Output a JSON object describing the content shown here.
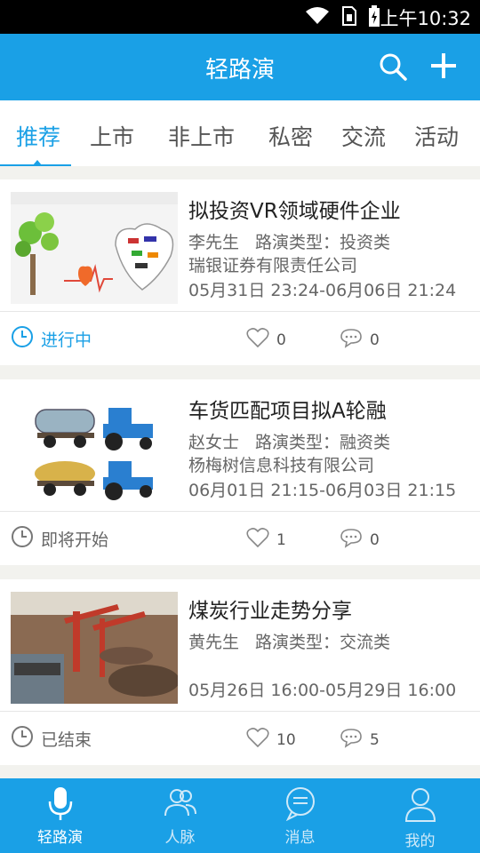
{
  "status_bar": {
    "time": "上午10:32"
  },
  "app_bar": {
    "title": "轻路演"
  },
  "tabs": [
    "推荐",
    "上市",
    "非上市",
    "私密",
    "交流",
    "活动"
  ],
  "cards": [
    {
      "title": "拟投资VR领域硬件企业",
      "person": "李先生",
      "type": "路演类型：投资类",
      "company": "瑞银证券有限责任公司",
      "time": "05月31日 23:24-06月06日 21:24",
      "status": "进行中",
      "likes": "0",
      "comments": "0",
      "thumb": "互联网共享经济插图"
    },
    {
      "title": "车货匹配项目拟A轮融",
      "person": "赵女士",
      "type": "路演类型：融资类",
      "company": "杨梅树信息科技有限公司",
      "time": "06月01日 21:15-06月03日 21:15",
      "status": "即将开始",
      "likes": "1",
      "comments": "0",
      "thumb": "拖拉机插图"
    },
    {
      "title": "煤炭行业走势分享",
      "person": "黄先生",
      "type": "路演类型：交流类",
      "company": "",
      "time": "05月26日 16:00-05月29日 16:00",
      "status": "已结束",
      "likes": "10",
      "comments": "5",
      "thumb": "港口煤炭照片"
    }
  ],
  "bottom_nav": [
    "轻路演",
    "人脉",
    "消息",
    "我的"
  ],
  "colors": {
    "accent": "#1aa0e6",
    "background": "#f2f2ee"
  },
  "icons": {
    "app_bar": [
      "search-icon",
      "plus-icon"
    ],
    "status": [
      "clock-icon"
    ],
    "card_actions": [
      "heart-icon",
      "comment-icon"
    ],
    "bottom_nav": [
      "microphone-icon",
      "contacts-icon",
      "message-icon",
      "person-icon"
    ]
  }
}
